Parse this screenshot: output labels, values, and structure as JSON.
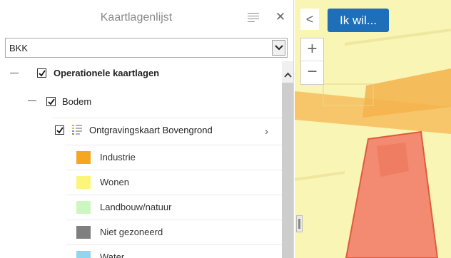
{
  "panel": {
    "title": "Kaartlagenlijst",
    "close_symbol": "✕",
    "list_icon": "list-icon"
  },
  "layer_select": {
    "value": "BKK"
  },
  "tree": {
    "group": {
      "label": "Operationele kaartlagen",
      "checked": true
    },
    "subgroup": {
      "label": "Bodem",
      "checked": true
    },
    "layer": {
      "label": "Ontgravingskaart Bovengrond",
      "checked": true
    },
    "legend": [
      {
        "label": "Industrie",
        "color": "#f5a623"
      },
      {
        "label": "Wonen",
        "color": "#fbf67a"
      },
      {
        "label": "Landbouw/natuur",
        "color": "#cdf7c0"
      },
      {
        "label": "Niet gezoneerd",
        "color": "#7f7f7f"
      },
      {
        "label": "Water",
        "color": "#8fd7ef"
      }
    ]
  },
  "map": {
    "collapse_symbol": "<",
    "action_button": "Ik wil...",
    "zoom_in": "+",
    "zoom_out": "−",
    "colors": {
      "background": "#f8f5b5",
      "orange_band": "#f7c162",
      "red_parcel": "#f28b72"
    }
  }
}
